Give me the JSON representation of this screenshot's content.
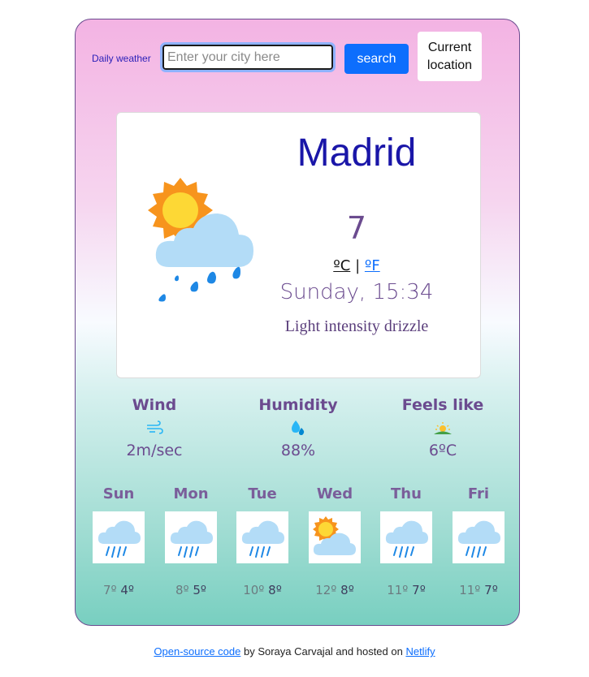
{
  "header": {
    "brand": "Daily weather",
    "search_placeholder": "Enter your city here",
    "search_label": "search",
    "location_label_line1": "Current",
    "location_label_line2": "location"
  },
  "current": {
    "city": "Madrid",
    "temperature": "7",
    "unit_c": "ºC",
    "unit_sep": "|",
    "unit_f": "ºF",
    "date": "Sunday, 15:34",
    "description": "Light intensity drizzle",
    "icon": "sun-cloud-drizzle-icon"
  },
  "details": {
    "wind": {
      "label": "Wind",
      "value": "2m/sec",
      "icon": "wind-icon"
    },
    "humidity": {
      "label": "Humidity",
      "value": "88%",
      "icon": "humidity-icon"
    },
    "feels_like": {
      "label": "Feels like",
      "value": "6ºC",
      "icon": "sunrise-icon"
    }
  },
  "forecast": [
    {
      "day": "Sun",
      "max": "7º",
      "min": "4º",
      "icon": "rain-cloud-icon"
    },
    {
      "day": "Mon",
      "max": "8º",
      "min": "5º",
      "icon": "rain-cloud-icon"
    },
    {
      "day": "Tue",
      "max": "10º",
      "min": "8º",
      "icon": "rain-cloud-icon"
    },
    {
      "day": "Wed",
      "max": "12º",
      "min": "8º",
      "icon": "sun-cloud-icon"
    },
    {
      "day": "Thu",
      "max": "11º",
      "min": "7º",
      "icon": "rain-cloud-icon"
    },
    {
      "day": "Fri",
      "max": "11º",
      "min": "7º",
      "icon": "rain-cloud-icon"
    }
  ],
  "footer": {
    "link1": "Open-source code",
    "middle": " by Soraya Carvajal and hosted on ",
    "link2": "Netlify"
  },
  "colors": {
    "accent": "#0d6efd",
    "city": "#1a16a8",
    "text": "#6b4b8f"
  }
}
